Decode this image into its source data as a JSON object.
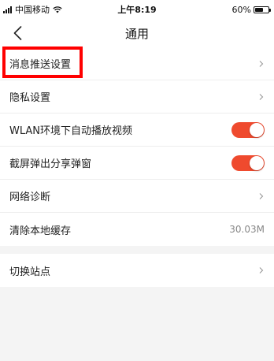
{
  "status_bar": {
    "carrier": "中国移动",
    "time": "上午8:19",
    "battery_text": "60%",
    "battery_level": 0.6
  },
  "header": {
    "back_icon": "chevron-left-icon",
    "title": "通用"
  },
  "settings": {
    "rows": [
      {
        "label": "消息推送设置",
        "control": "chevron"
      },
      {
        "label": "隐私设置",
        "control": "chevron"
      },
      {
        "label": "WLAN环境下自动播放视频",
        "control": "toggle",
        "on": true
      },
      {
        "label": "截屏弹出分享弹窗",
        "control": "toggle",
        "on": true
      },
      {
        "label": "网络诊断",
        "control": "chevron"
      },
      {
        "label": "清除本地缓存",
        "control": "value",
        "value": "30.03M"
      }
    ],
    "group2": [
      {
        "label": "切换站点",
        "control": "chevron"
      }
    ]
  },
  "colors": {
    "toggle_on": "#ef4a2e",
    "highlight": "#ff0000",
    "background": "#f4f4f4"
  }
}
